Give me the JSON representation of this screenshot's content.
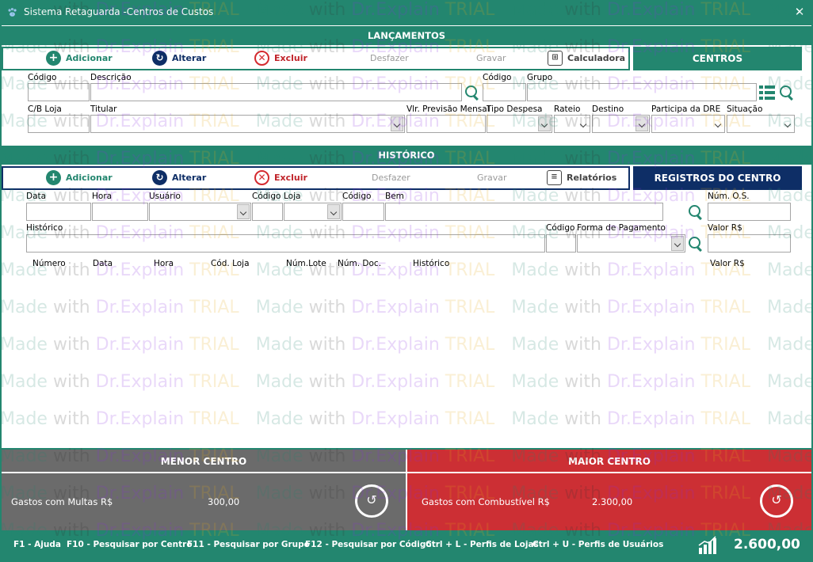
{
  "window": {
    "title": "Sistema Retaguarda -Centros de Custos",
    "close_glyph": "✕"
  },
  "lancamentos": {
    "title": "LANÇAMENTOS",
    "toolbar": {
      "add": "Adicionar",
      "alter": "Alterar",
      "delete": "Excluir",
      "undo": "Desfazer",
      "save": "Gravar",
      "calc": "Calculadora"
    },
    "tab": "CENTROS",
    "labels": {
      "codigo": "Código",
      "descricao": "Descrição",
      "codigo2": "Código",
      "grupo": "Grupo",
      "cb_loja": "C/B Loja",
      "titular": "Titular",
      "vlr_previsao": "Vlr. Previsão Mensal",
      "tipo_despesa": "Tipo Despesa",
      "rateio": "Rateio",
      "destino": "Destino",
      "participa_dre": "Participa da DRE",
      "situacao": "Situação"
    }
  },
  "historico": {
    "title": "HISTÓRICO",
    "toolbar": {
      "add": "Adicionar",
      "alter": "Alterar",
      "delete": "Excluir",
      "undo": "Desfazer",
      "save": "Gravar",
      "report": "Relatórios"
    },
    "tab": "REGISTROS DO CENTRO",
    "labels": {
      "data": "Data",
      "hora": "Hora",
      "usuario": "Usuário",
      "codigo": "Código",
      "loja": "Loja",
      "codigo2": "Código",
      "bem": "Bem",
      "num_os": "Núm. O.S.",
      "historico": "Histórico",
      "codigo3": "Código",
      "forma_pagamento": "Forma de Pagamento",
      "valor": "Valor R$"
    },
    "columns": [
      "Número",
      "Data",
      "Hora",
      "Cód. Loja",
      "Núm.Lote",
      "Núm. Doc.",
      "Histórico",
      "Valor R$"
    ]
  },
  "menor": {
    "title": "MENOR CENTRO",
    "label": "Gastos com Multas R$",
    "value": "300,00"
  },
  "maior": {
    "title": "MAIOR CENTRO",
    "label": "Gastos com Combustível R$",
    "value": "2.300,00"
  },
  "footer": {
    "keys": [
      "F1 - Ajuda",
      "F10 - Pesquisar por Centro",
      "F11 - Pesquisar por Grupo",
      "F12 - Pesquisar por Código",
      "Ctrl + L - Perfis de Lojas",
      "Ctrl + U - Perfis de Usuários"
    ],
    "total": "2.600,00"
  },
  "watermark": {
    "made": "Made",
    "with": "with",
    "brand": "Dr.Explain",
    "trial": "TRIAL"
  },
  "colors": {
    "accent": "#23866f",
    "navy": "#0e2e66",
    "red": "#cc2f34",
    "gray": "#6b6b6b"
  }
}
